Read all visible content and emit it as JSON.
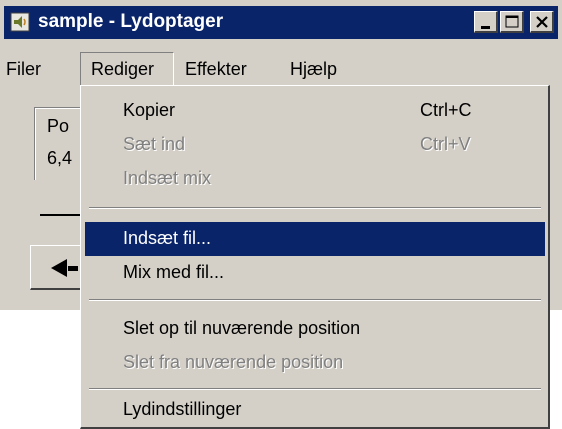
{
  "window": {
    "title": "sample - Lydoptager",
    "icon": "speaker-icon",
    "buttons": [
      "minimize-icon",
      "maximize-icon",
      "close-icon"
    ]
  },
  "menubar": {
    "items": [
      {
        "label": "Filer"
      },
      {
        "label": "Rediger"
      },
      {
        "label": "Effekter"
      },
      {
        "label": "Hjælp"
      }
    ]
  },
  "status": {
    "position_label": "Po",
    "position_value": "6,4"
  },
  "controls": {
    "play_icon": "seek-start-icon"
  },
  "edit_menu": {
    "items": [
      {
        "label": "Kopier",
        "shortcut": "Ctrl+C",
        "enabled": true
      },
      {
        "label": "Sæt ind",
        "shortcut": "Ctrl+V",
        "enabled": false
      },
      {
        "label": "Indsæt mix",
        "shortcut": "",
        "enabled": false
      },
      {
        "label": "Indsæt fil...",
        "shortcut": "",
        "enabled": true,
        "highlighted": true
      },
      {
        "label": "Mix med fil...",
        "shortcut": "",
        "enabled": true
      },
      {
        "label": "Slet op til nuværende position",
        "shortcut": "",
        "enabled": true
      },
      {
        "label": "Slet fra nuværende position",
        "shortcut": "",
        "enabled": false
      },
      {
        "label": "Lydindstillinger",
        "shortcut": "",
        "enabled": true
      }
    ]
  },
  "colors": {
    "titlebar": "#0a246a",
    "highlight": "#0a246a",
    "face": "#d4d0c8",
    "disabled_text": "#808080"
  }
}
